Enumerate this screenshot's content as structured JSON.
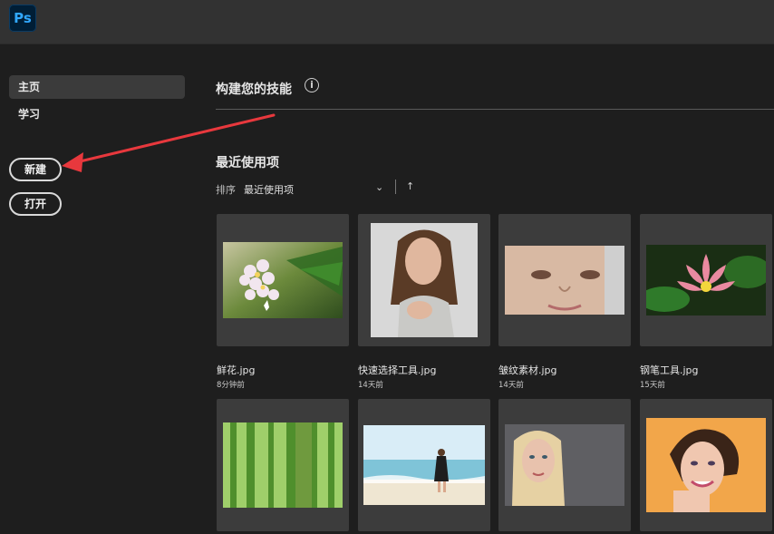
{
  "app": {
    "logo_text": "Ps"
  },
  "sidebar": {
    "items": [
      {
        "label": "主页",
        "active": true
      },
      {
        "label": "学习",
        "active": false
      }
    ],
    "new_button": "新建",
    "open_button": "打开"
  },
  "main": {
    "heading": "构建您的技能",
    "info_icon": "i",
    "recent_title": "最近使用项",
    "sort_label": "排序",
    "sort_value": "最近使用项",
    "sort_chevron": "⌄",
    "sort_direction": "↑"
  },
  "files": [
    {
      "name": "鲜花.jpg",
      "time": "8分钟前"
    },
    {
      "name": "快速选择工具.jpg",
      "time": "14天前"
    },
    {
      "name": "皱纹素材.jpg",
      "time": "14天前"
    },
    {
      "name": "钢笔工具.jpg",
      "time": "15天前"
    }
  ],
  "colors": {
    "accent_arrow": "#e8383d",
    "ps_blue": "#31a8ff"
  }
}
